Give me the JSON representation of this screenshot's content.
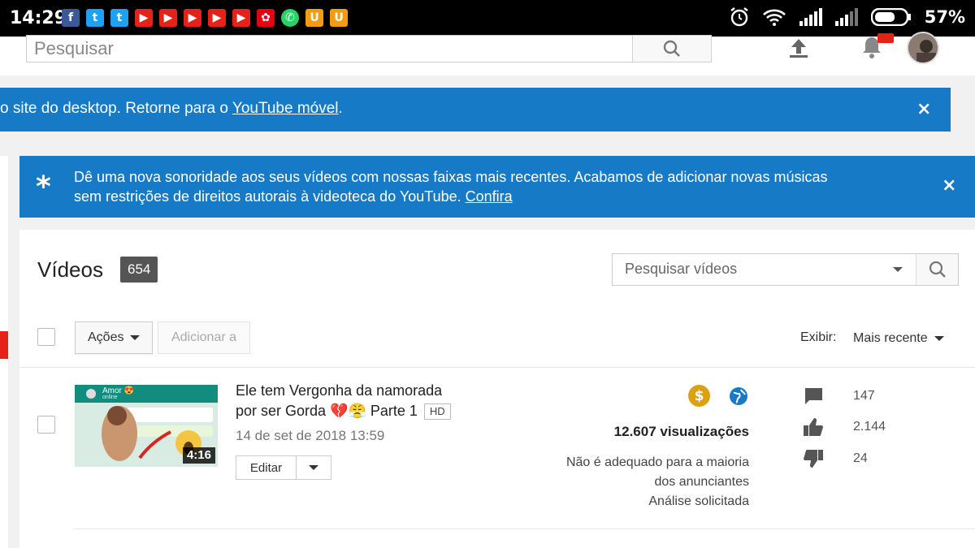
{
  "status_bar": {
    "time": "14:29",
    "battery": "57%",
    "notification_icons": [
      "facebook-icon",
      "twitter-icon",
      "twitter-icon",
      "youtube-icon",
      "youtube-icon",
      "youtube-icon",
      "youtube-icon",
      "youtube-icon",
      "huawei-icon",
      "whatsapp-icon",
      "uc-browser-icon",
      "uc-browser-icon"
    ],
    "right_icons": [
      "alarm-icon",
      "wifi-icon",
      "signal-icon",
      "signal-icon",
      "battery-icon"
    ]
  },
  "header": {
    "search_placeholder": "Pesquisar"
  },
  "banner_desktop": {
    "text": "o site do desktop. Retorne para o ",
    "link": "YouTube móvel",
    "suffix": "."
  },
  "banner_music": {
    "text": "Dê uma nova sonoridade aos seus vídeos com nossas faixas mais recentes. Acabamos de adicionar novas músicas",
    "text2": "sem restrições de direitos autorais à videoteca do YouTube. ",
    "link": "Confira"
  },
  "videos": {
    "title": "Vídeos",
    "count": "654",
    "search_placeholder": "Pesquisar vídeos",
    "actions_label": "Ações",
    "add_to_label": "Adicionar a",
    "show_label": "Exibir:",
    "sort_label": "Mais recente"
  },
  "video_row": {
    "title_line1": "Ele tem Vergonha da namorada",
    "title_line2": "por ser Gorda 💔😤 Parte 1",
    "hd": "HD",
    "date": "14 de set de 2018 13:59",
    "duration": "4:16",
    "edit_label": "Editar",
    "views": "12.607 visualizações",
    "ad_status": [
      "Não é adequado para a maioria",
      "dos anunciantes",
      "Análise solicitada"
    ],
    "comments": "147",
    "likes": "2.144",
    "dislikes": "24",
    "thumb_header": "Amor 😍",
    "thumb_status": "online"
  },
  "colors": {
    "banner_blue": "#167ac6",
    "yt_red": "#e62117",
    "money_gold": "#dba10f"
  }
}
